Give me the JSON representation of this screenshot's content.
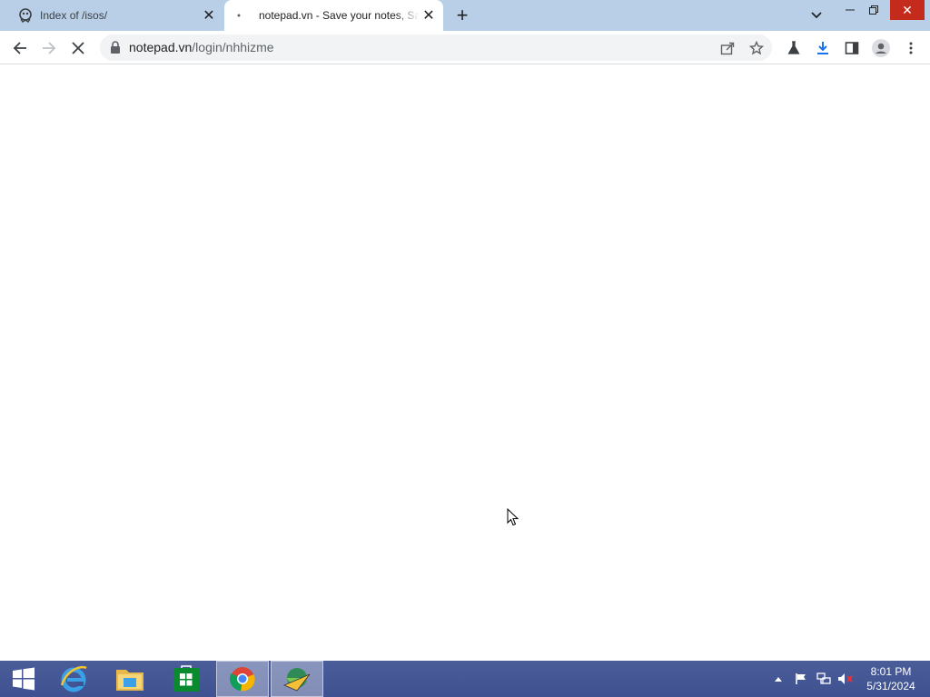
{
  "browser": {
    "tabs": [
      {
        "title": "Index of /isos/",
        "active": false
      },
      {
        "title": "notepad.vn - Save your notes, Sa",
        "active": true
      }
    ],
    "address": {
      "host": "notepad.vn",
      "path": "/login/nhhizme"
    }
  },
  "taskbar": {
    "apps": [
      "windows-start",
      "internet-explorer",
      "file-explorer",
      "windows-store",
      "chrome",
      "internet-download-manager"
    ],
    "clock": {
      "time": "8:01 PM",
      "date": "5/31/2024"
    }
  },
  "colors": {
    "tabstrip": "#b9cfe8",
    "taskbar": "#4a5d99",
    "close_red": "#c42b1c",
    "accent_blue": "#1a73e8"
  }
}
